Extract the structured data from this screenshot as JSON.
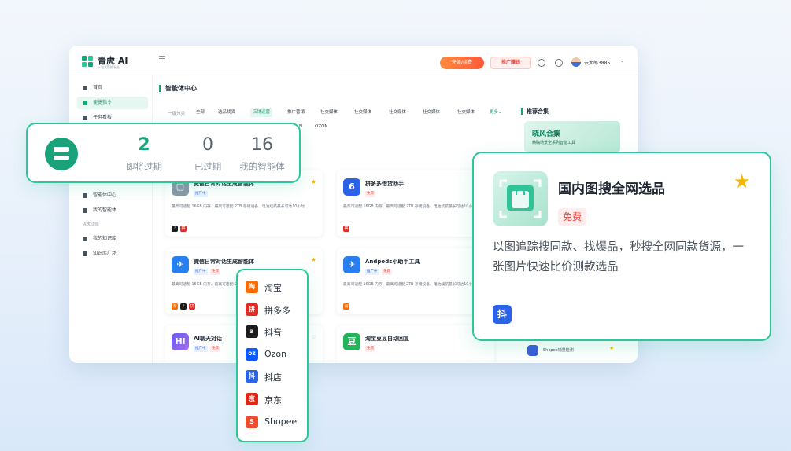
{
  "app": {
    "title": "青虎 AI",
    "subtitle": "一站式智能平台",
    "colors": {
      "brand": "#1aa37a",
      "accent": "#2dc79b",
      "danger": "#e8453c",
      "star": "#f5b400"
    }
  },
  "topbar": {
    "recharge_label": "充值/续费",
    "promo_label": "推广赚钱",
    "icons": [
      "help-icon",
      "refresh-icon"
    ],
    "username": "云大郎3885"
  },
  "sidebar": {
    "items": [
      {
        "label": "首页",
        "icon": "home-icon",
        "active": false
      },
      {
        "label": "便捷指令",
        "icon": "command-icon",
        "active": true
      },
      {
        "label": "任务看板",
        "icon": "board-icon",
        "active": false
      }
    ],
    "items_lower": [
      {
        "label": "智能体中心",
        "icon": "grid-icon"
      },
      {
        "label": "我的智能体",
        "icon": "grid-icon"
      }
    ],
    "group_label": "AI知识库",
    "kb_items": [
      {
        "label": "我的知识库",
        "icon": "book-icon"
      },
      {
        "label": "知识库广场",
        "icon": "square-icon"
      }
    ]
  },
  "main": {
    "page_title": "智能体中心",
    "filter_label": "一级分类",
    "chips": [
      "全部",
      "选品找货",
      "店铺运营",
      "推广营销",
      "社交媒体",
      "社交媒体",
      "社交媒体",
      "社交媒体",
      "社交媒体"
    ],
    "active_chip": 2,
    "more_label": "更多",
    "chips_row2": [
      "N",
      "OZON"
    ],
    "cards": [
      {
        "title": "微信日常对话生成智能体",
        "tags": [
          "推广中"
        ],
        "desc": "最高可适配 16GB 内存、最高可适配 2TB 存储设备、电池续航最长可达10小时",
        "star": true
      },
      {
        "title": "拼多多借贷助手",
        "tags": [
          "免费"
        ],
        "desc": "最高可适配 16GB 内存、最高可适配 2TB 存储设备、电池续航最长可达10小时",
        "star": false
      },
      {
        "title": "微信日常对话生成智能体",
        "tags": [
          "推广中",
          "免费"
        ],
        "desc": "最高可适配 16GB 内存、最高可适配 2TB 存储设备、电池续航最长可达10小时",
        "star": true
      },
      {
        "title": "Andpods小助手工具",
        "tags": [
          "推广中",
          "免费"
        ],
        "desc": "最高可适配 16GB 内存、最高可适配 2TB 存储设备、电池续航最长可达10小时",
        "star": false
      },
      {
        "title": "AI聊天对话",
        "tags": [
          "推广中",
          "免费"
        ],
        "desc": "",
        "star": false
      },
      {
        "title": "淘宝豆豆自动回复",
        "tags": [
          "免费"
        ],
        "desc": "",
        "star": false
      }
    ]
  },
  "recommend": {
    "title": "推荐合集",
    "banner_title": "晓风合集",
    "banner_sub": "精确场景全系列智能工具",
    "item_label": "Shopee销量检测"
  },
  "stats": {
    "icon": "server-icon",
    "items": [
      {
        "value": "2",
        "label": "即将过期",
        "color": "#1aa37a"
      },
      {
        "value": "0",
        "label": "已过期",
        "color": "#5a626c"
      },
      {
        "value": "16",
        "label": "我的智能体",
        "color": "#5a626c"
      }
    ]
  },
  "platforms": [
    {
      "label": "淘宝",
      "icon": "淘",
      "color": "#ff6a00"
    },
    {
      "label": "拼多多",
      "icon": "拼",
      "color": "#e02e24"
    },
    {
      "label": "抖音",
      "icon": "a",
      "color": "#1c1c1c"
    },
    {
      "label": "Ozon",
      "icon": "OZ",
      "color": "#0a5bff"
    },
    {
      "label": "抖店",
      "icon": "抖",
      "color": "#2a62e8"
    },
    {
      "label": "京东",
      "icon": "京",
      "color": "#e1251b"
    },
    {
      "label": "Shopee",
      "icon": "S",
      "color": "#ee4d2d"
    }
  ],
  "detail": {
    "title": "国内图搜全网选品",
    "badge": "免费",
    "description": "以图追踪搜同款、找爆品，秒搜全网同款货源，一张图片快速比价测款选品",
    "platform_icon": "抖"
  }
}
